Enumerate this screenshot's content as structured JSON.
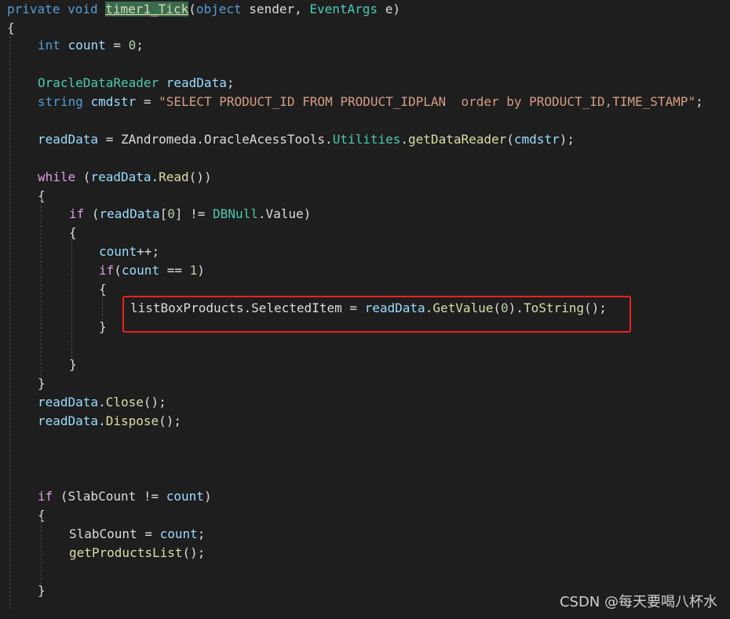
{
  "code": {
    "lines": [
      [
        {
          "t": "private",
          "c": "kw"
        },
        {
          "t": " ",
          "c": "pl"
        },
        {
          "t": "void",
          "c": "kw"
        },
        {
          "t": " ",
          "c": "pl"
        },
        {
          "t": "timer1_Tick",
          "c": "hl"
        },
        {
          "t": "(",
          "c": "pl"
        },
        {
          "t": "object",
          "c": "kw"
        },
        {
          "t": " sender, ",
          "c": "pl"
        },
        {
          "t": "EventArgs",
          "c": "typ"
        },
        {
          "t": " e)",
          "c": "pl"
        }
      ],
      [
        {
          "t": "{",
          "c": "pl"
        }
      ],
      [],
      [
        {
          "t": "int",
          "c": "kw"
        },
        {
          "t": " ",
          "c": "pl"
        },
        {
          "t": "count",
          "c": "vr"
        },
        {
          "t": " = ",
          "c": "pl"
        },
        {
          "t": "0",
          "c": "num"
        },
        {
          "t": ";",
          "c": "pl"
        }
      ],
      [],
      [
        {
          "t": "OracleDataReader",
          "c": "typ"
        },
        {
          "t": " ",
          "c": "pl"
        },
        {
          "t": "readData",
          "c": "vr"
        },
        {
          "t": ";",
          "c": "pl"
        }
      ],
      [
        {
          "t": "string",
          "c": "kw"
        },
        {
          "t": " ",
          "c": "pl"
        },
        {
          "t": "cmdstr",
          "c": "vr"
        },
        {
          "t": " = ",
          "c": "pl"
        },
        {
          "t": "\"SELECT PRODUCT_ID FROM PRODUCT_IDPLAN  order by PRODUCT_ID,TIME_STAMP\"",
          "c": "str"
        },
        {
          "t": ";",
          "c": "pl"
        }
      ],
      [],
      [
        {
          "t": "readData",
          "c": "vr"
        },
        {
          "t": " = ZAndromeda.OracleAcessTools.",
          "c": "pl"
        },
        {
          "t": "Utilities",
          "c": "typ"
        },
        {
          "t": ".",
          "c": "pl"
        },
        {
          "t": "getDataReader",
          "c": "fn"
        },
        {
          "t": "(",
          "c": "pl"
        },
        {
          "t": "cmdstr",
          "c": "vr"
        },
        {
          "t": ");",
          "c": "pl"
        }
      ],
      [],
      [
        {
          "t": "while",
          "c": "ctl"
        },
        {
          "t": " (",
          "c": "pl"
        },
        {
          "t": "readData",
          "c": "vr"
        },
        {
          "t": ".",
          "c": "pl"
        },
        {
          "t": "Read",
          "c": "fn"
        },
        {
          "t": "())",
          "c": "pl"
        }
      ],
      [
        {
          "t": "{",
          "c": "pl"
        }
      ],
      [
        {
          "t": "if",
          "c": "ctl"
        },
        {
          "t": " (",
          "c": "pl"
        },
        {
          "t": "readData",
          "c": "vr"
        },
        {
          "t": "[",
          "c": "pl"
        },
        {
          "t": "0",
          "c": "num"
        },
        {
          "t": "] != ",
          "c": "pl"
        },
        {
          "t": "DBNull",
          "c": "typ"
        },
        {
          "t": ".Value)",
          "c": "pl"
        }
      ],
      [
        {
          "t": "{",
          "c": "pl"
        }
      ],
      [
        {
          "t": "count",
          "c": "vr"
        },
        {
          "t": "++;",
          "c": "pl"
        }
      ],
      [
        {
          "t": "if",
          "c": "ctl"
        },
        {
          "t": "(",
          "c": "pl"
        },
        {
          "t": "count",
          "c": "vr"
        },
        {
          "t": " == ",
          "c": "pl"
        },
        {
          "t": "1",
          "c": "num"
        },
        {
          "t": ")",
          "c": "pl"
        }
      ],
      [
        {
          "t": "{",
          "c": "pl"
        }
      ],
      [
        {
          "t": "listBoxProducts.SelectedItem = ",
          "c": "pl"
        },
        {
          "t": "readData",
          "c": "vr"
        },
        {
          "t": ".",
          "c": "pl"
        },
        {
          "t": "GetValue",
          "c": "fn"
        },
        {
          "t": "(",
          "c": "pl"
        },
        {
          "t": "0",
          "c": "num"
        },
        {
          "t": ").",
          "c": "pl"
        },
        {
          "t": "ToString",
          "c": "fn"
        },
        {
          "t": "();",
          "c": "pl"
        }
      ],
      [
        {
          "t": "}",
          "c": "pl"
        }
      ],
      [],
      [],
      [
        {
          "t": "}",
          "c": "pl"
        }
      ],
      [],
      [
        {
          "t": "}",
          "c": "pl"
        }
      ],
      [
        {
          "t": "readData",
          "c": "vr"
        },
        {
          "t": ".",
          "c": "pl"
        },
        {
          "t": "Close",
          "c": "fn"
        },
        {
          "t": "();",
          "c": "pl"
        }
      ],
      [
        {
          "t": "readData",
          "c": "vr"
        },
        {
          "t": ".",
          "c": "pl"
        },
        {
          "t": "Dispose",
          "c": "fn"
        },
        {
          "t": "();",
          "c": "pl"
        }
      ],
      [],
      [],
      [],
      [],
      [],
      [
        {
          "t": "if",
          "c": "ctl"
        },
        {
          "t": " (SlabCount != ",
          "c": "pl"
        },
        {
          "t": "count",
          "c": "vr"
        },
        {
          "t": ")",
          "c": "pl"
        }
      ],
      [
        {
          "t": "{",
          "c": "pl"
        }
      ],
      [],
      [
        {
          "t": "SlabCount = ",
          "c": "pl"
        },
        {
          "t": "count",
          "c": "vr"
        },
        {
          "t": ";",
          "c": "pl"
        }
      ],
      [
        {
          "t": "getProductsList",
          "c": "fn"
        },
        {
          "t": "();",
          "c": "pl"
        }
      ],
      [],
      [],
      [
        {
          "t": "}",
          "c": "pl"
        }
      ],
      [],
      [
        {
          "t": "}",
          "c": "pl"
        }
      ]
    ]
  },
  "watermark": "CSDN @每天要喝八杯水"
}
